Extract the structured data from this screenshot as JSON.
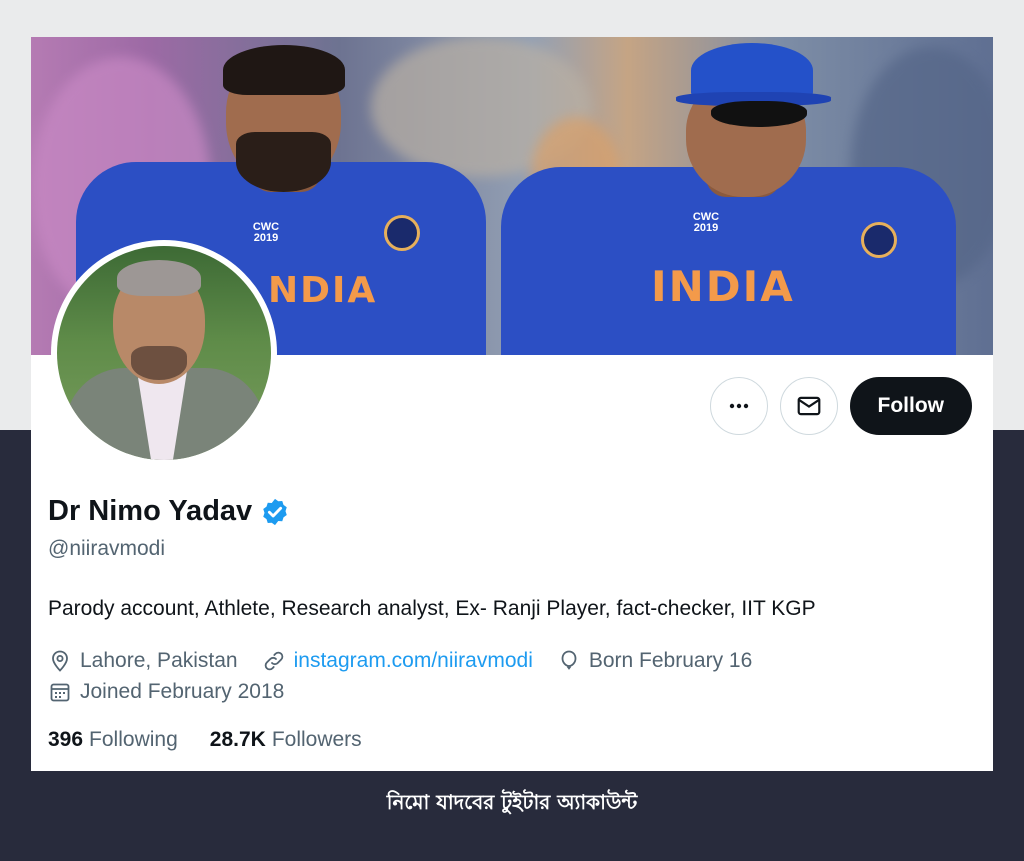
{
  "profile": {
    "name": "Dr Nimo Yadav",
    "handle": "@niiravmodi",
    "bio": "Parody account, Athlete, Research analyst, Ex- Ranji Player, fact-checker, IIT KGP",
    "location": "Lahore, Pakistan",
    "website": "instagram.com/niiravmodi",
    "birthday": "Born February 16",
    "joined": "Joined February 2018",
    "verified_icon": "verified-badge-icon"
  },
  "stats": {
    "following_count": "396",
    "following_label": "Following",
    "followers_count": "28.7K",
    "followers_label": "Followers"
  },
  "actions": {
    "more_icon": "more-icon",
    "message_icon": "mail-icon",
    "follow_label": "Follow"
  },
  "banner": {
    "jersey_text_left": "NDIA",
    "jersey_text_right": "INDIA"
  },
  "caption": "নিমো যাদবের টুইটার অ্যাকাউন্ট",
  "colors": {
    "accent": "#1d9bf0",
    "text_primary": "#0f1419",
    "text_secondary": "#536471",
    "follow_bg": "#0f1419",
    "page_bg": "#282b3c"
  }
}
